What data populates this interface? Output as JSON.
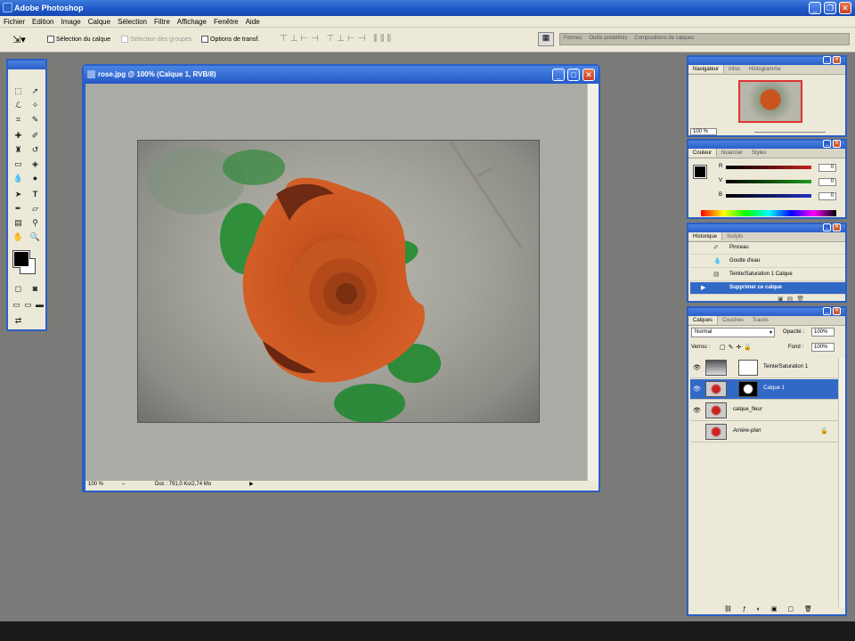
{
  "app": {
    "title": "Adobe Photoshop",
    "menus": [
      "Fichier",
      "Edition",
      "Image",
      "Calque",
      "Sélection",
      "Filtre",
      "Affichage",
      "Fenêtre",
      "Aide"
    ]
  },
  "options": {
    "auto_select_layer": "Sélection du calque",
    "auto_select_groups": "Sélection des groupes",
    "transform_options": "Options de transf.",
    "palette_well": [
      "Formes",
      "Outils prédéfinis",
      "Compositions de calques"
    ]
  },
  "document": {
    "title": "rose.jpg @ 100% (Calque 1, RVB/8)",
    "zoom": "100 %",
    "doc_size": "Doc : 791,0 Ko/2,74 Mo"
  },
  "navigator": {
    "tabs": [
      "Navigateur",
      "Infos",
      "Histogramme"
    ],
    "zoom": "100 %"
  },
  "color": {
    "tabs": [
      "Couleur",
      "Nuancier",
      "Styles"
    ],
    "channels": [
      {
        "label": "R",
        "value": "0",
        "color": "#c42020"
      },
      {
        "label": "V",
        "value": "0",
        "color": "#1c9a1c"
      },
      {
        "label": "B",
        "value": "0",
        "color": "#2030c0"
      }
    ]
  },
  "history": {
    "tabs": [
      "Historique",
      "Scripts"
    ],
    "items": [
      "Pinceau",
      "Goutte d'eau",
      "Teinte/Saturation 1 Calque",
      "Supprimer ce calque"
    ],
    "selected_index": 3
  },
  "layers": {
    "tabs": [
      "Calques",
      "Couches",
      "Tracés"
    ],
    "blend_mode": "Normal",
    "opacity_label": "Opacité :",
    "opacity": "100%",
    "lock_label": "Verrou :",
    "fill_label": "Fond :",
    "fill": "100%",
    "items": [
      {
        "name": "Teinte/Saturation 1",
        "selected": false
      },
      {
        "name": "Calque 1",
        "selected": true
      },
      {
        "name": "calque_fleur",
        "selected": false
      },
      {
        "name": "Arrière-plan",
        "selected": false
      }
    ]
  }
}
